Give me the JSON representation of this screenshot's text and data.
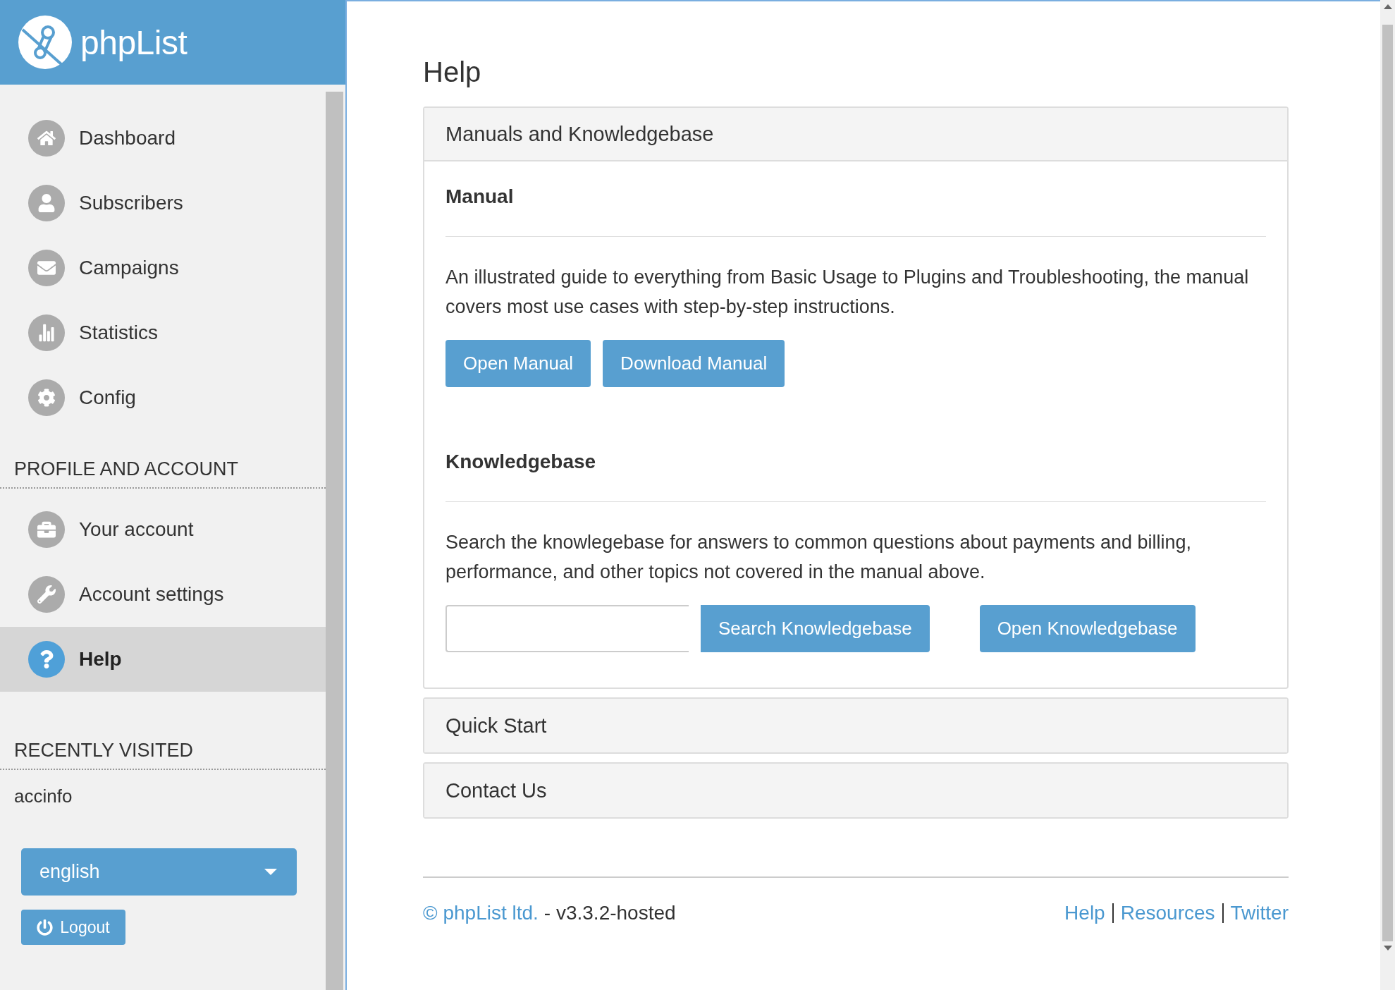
{
  "logo": {
    "text": "phpList"
  },
  "sidebar": {
    "nav": [
      {
        "label": "Dashboard",
        "selected": false
      },
      {
        "label": "Subscribers",
        "selected": false
      },
      {
        "label": "Campaigns",
        "selected": false
      },
      {
        "label": "Statistics",
        "selected": false
      },
      {
        "label": "Config",
        "selected": false
      }
    ],
    "profile_heading": "PROFILE AND ACCOUNT",
    "profile_items": [
      {
        "label": "Your account",
        "selected": false
      },
      {
        "label": "Account settings",
        "selected": false
      },
      {
        "label": "Help",
        "selected": true
      }
    ],
    "recent_heading": "RECENTLY VISITED",
    "recent_items": [
      "accinfo"
    ],
    "language": {
      "value": "english"
    },
    "logout": "Logout"
  },
  "page": {
    "title": "Help",
    "panels": [
      {
        "title": "Manuals and Knowledgebase",
        "expanded": true,
        "sections": [
          {
            "heading": "Manual",
            "text": "An illustrated guide to everything from Basic Usage to Plugins and Troubleshooting, the manual covers most use cases with step-by-step instructions.",
            "buttons": [
              "Open Manual",
              "Download Manual"
            ]
          },
          {
            "heading": "Knowledgebase",
            "text": "Search the knowlegebase for answers to common questions about payments and billing, performance, and other topics not covered in the manual above.",
            "search_button": "Search Knowledgebase",
            "buttons": [
              "Open Knowledgebase"
            ]
          }
        ]
      },
      {
        "title": "Quick Start",
        "expanded": false
      },
      {
        "title": "Contact Us",
        "expanded": false
      }
    ]
  },
  "footer": {
    "copyright": "© phpList ltd.",
    "version": "- v3.3.2-hosted",
    "links": [
      "Help",
      "Resources",
      "Twitter"
    ]
  }
}
